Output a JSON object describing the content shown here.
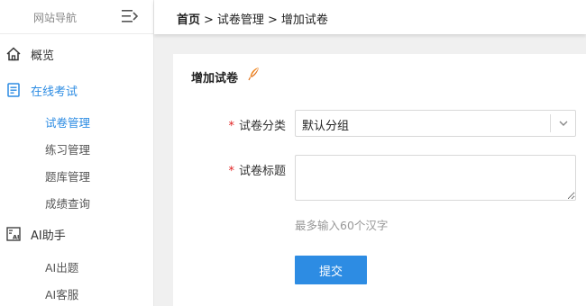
{
  "sidebar": {
    "title": "网站导航",
    "items": [
      {
        "label": "概览",
        "icon": "home-icon"
      },
      {
        "label": "在线考试",
        "icon": "exam-icon"
      },
      {
        "label": "AI助手",
        "icon": "ai-icon"
      }
    ],
    "exam_subitems": [
      {
        "label": "试卷管理"
      },
      {
        "label": "练习管理"
      },
      {
        "label": "题库管理"
      },
      {
        "label": "成绩查询"
      }
    ],
    "ai_subitems": [
      {
        "label": "AI出题"
      },
      {
        "label": "AI客服"
      }
    ]
  },
  "breadcrumb": {
    "home": "首页",
    "sep": ">",
    "level1": "试卷管理",
    "level2": "增加试卷"
  },
  "form": {
    "title": "增加试卷",
    "required_mark": "*",
    "category_label": "试卷分类",
    "category_value": "默认分组",
    "title_label": "试卷标题",
    "title_value": "",
    "hint": "最多输入60个汉字",
    "submit_label": "提交"
  },
  "colors": {
    "accent": "#2d8ce3",
    "required": "#e02020",
    "feather": "#f08a24"
  }
}
